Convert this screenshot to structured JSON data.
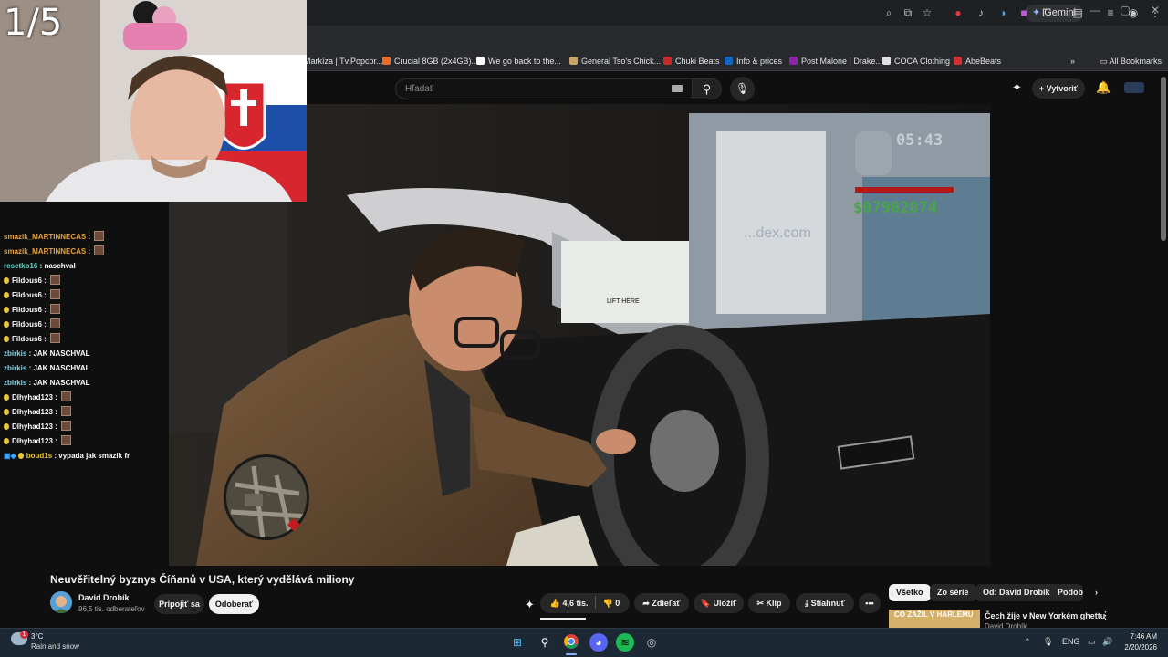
{
  "browser": {
    "gemini_label": "Gemini",
    "bookmarks": [
      {
        "label": "Markíza | Tv.Popcor...",
        "color": "#e0532e"
      },
      {
        "label": "Crucial 8GB (2x4GB)...",
        "color": "#f06a2a"
      },
      {
        "label": "We go back to the...",
        "color": "#ffffff"
      },
      {
        "label": "General Tso's Chick...",
        "color": "#c8a36a"
      },
      {
        "label": "Chuki Beats",
        "color": "#c92a2a"
      },
      {
        "label": "Info & prices",
        "color": "#1565c0"
      },
      {
        "label": "Post Malone | Drake...",
        "color": "#8e24aa"
      },
      {
        "label": "COCA Clothing",
        "color": "#e0e0e0"
      },
      {
        "label": "AbeBeats",
        "color": "#d32f2f"
      }
    ],
    "all_bookmarks_label": "All Bookmarks"
  },
  "youtube": {
    "search_placeholder": "Hľadať",
    "create_label": "Vytvoriť"
  },
  "stream": {
    "counter": "1/5",
    "chat": [
      {
        "user": "smazik_MARTINNECAS",
        "user_color": "#e8a23c",
        "text": "",
        "emote": true,
        "badge": false,
        "icons": ""
      },
      {
        "user": "smazik_MARTINNECAS",
        "user_color": "#e8a23c",
        "text": "",
        "emote": true,
        "badge": false,
        "icons": ""
      },
      {
        "user": "resetko16",
        "user_color": "#5fd6c8",
        "text": "naschval",
        "emote": false,
        "badge": false,
        "icons": ""
      },
      {
        "user": "Fildous6",
        "user_color": "#ffffff",
        "text": "",
        "emote": true,
        "badge": true,
        "icons": ""
      },
      {
        "user": "Fildous6",
        "user_color": "#ffffff",
        "text": "",
        "emote": true,
        "badge": true,
        "icons": ""
      },
      {
        "user": "Fildous6",
        "user_color": "#ffffff",
        "text": "",
        "emote": true,
        "badge": true,
        "icons": ""
      },
      {
        "user": "Fildous6",
        "user_color": "#ffffff",
        "text": "",
        "emote": true,
        "badge": true,
        "icons": ""
      },
      {
        "user": "Fildous6",
        "user_color": "#ffffff",
        "text": "",
        "emote": true,
        "badge": true,
        "icons": ""
      },
      {
        "user": "zbirkis",
        "user_color": "#7ad8e8",
        "text": "JAK NASCHVAL",
        "emote": false,
        "badge": false,
        "icons": ""
      },
      {
        "user": "zbirkis",
        "user_color": "#7ad8e8",
        "text": "JAK NASCHVAL",
        "emote": false,
        "badge": false,
        "icons": ""
      },
      {
        "user": "zbirkis",
        "user_color": "#7ad8e8",
        "text": "JAK NASCHVAL",
        "emote": false,
        "badge": false,
        "icons": ""
      },
      {
        "user": "Dlhyhad123",
        "user_color": "#ffffff",
        "text": "",
        "emote": true,
        "badge": true,
        "icons": ""
      },
      {
        "user": "Dlhyhad123",
        "user_color": "#ffffff",
        "text": "",
        "emote": true,
        "badge": true,
        "icons": ""
      },
      {
        "user": "Dlhyhad123",
        "user_color": "#ffffff",
        "text": "",
        "emote": true,
        "badge": true,
        "icons": ""
      },
      {
        "user": "Dlhyhad123",
        "user_color": "#ffffff",
        "text": "",
        "emote": true,
        "badge": true,
        "icons": ""
      },
      {
        "user": "boud1s",
        "user_color": "#e8c838",
        "text": "vypada jak smazik fr",
        "emote": false,
        "badge": true,
        "icons": "▣◆"
      }
    ]
  },
  "hud": {
    "time": "05:43",
    "money": "$07982074",
    "watermark": "...dex.com",
    "sign": "LIFT HERE"
  },
  "video": {
    "title": "Neuvěřitelný byznys Číňanů v USA, který vydělává miliony",
    "channel": "David Drobík",
    "subscribers": "96,5 tis. odberateľov",
    "join_label": "Pripojiť sa",
    "subscribe_label": "Odoberať",
    "likes": "4,6 tis.",
    "dislikes": "0",
    "share_label": "Zdieľať",
    "save_label": "Uložiť",
    "clip_label": "Klip",
    "download_label": "Stiahnuť",
    "more_label": "•••"
  },
  "recommendations": {
    "chips": [
      "Všetko",
      "Zo série",
      "Od: David Drobík",
      "Podob"
    ],
    "first_title": "Čech žije v New Yorkém ghettu",
    "first_channel": "David Drobík",
    "first_thumb_text": "CO ZAŽIL V HARLEMU"
  },
  "taskbar": {
    "temp": "3°C",
    "weather": "Rain and snow",
    "weather_badge": "1",
    "lang": "ENG",
    "time": "7:46 AM",
    "date": "2/20/2026"
  },
  "colors": {
    "accent": "#3ea6ff",
    "gta_money": "#4aa44a",
    "health": "#b51818"
  }
}
